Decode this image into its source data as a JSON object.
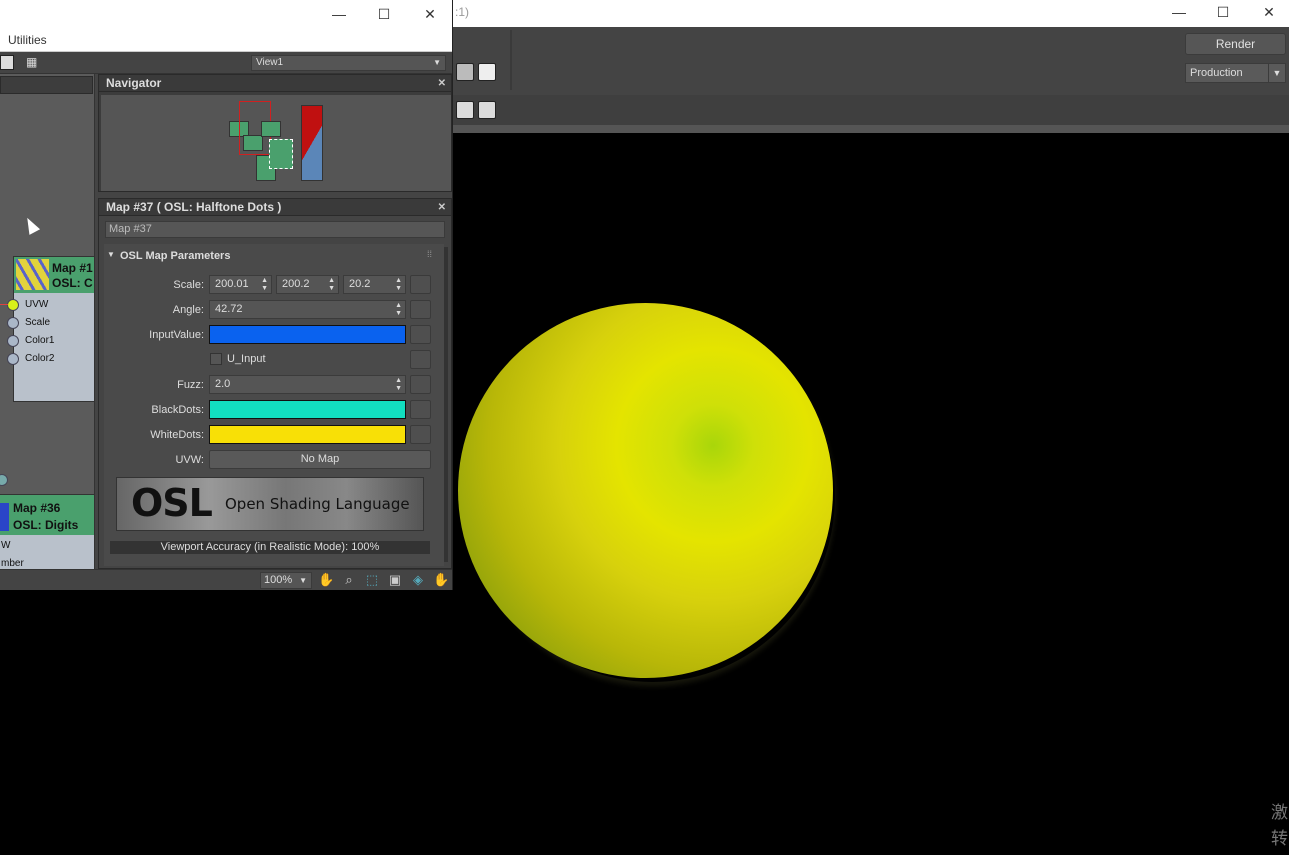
{
  "render_window": {
    "title_fragment": ":1)",
    "render_button": "Render",
    "preset": "Production",
    "watermark_line1": "激",
    "watermark_line2": "转",
    "sphere_colors": {
      "center": "#cfe008",
      "edge": "#6e8a10"
    }
  },
  "slate": {
    "menu": {
      "utilities": "Utilities"
    },
    "view_select": "View1",
    "navigator_title": "Navigator",
    "params_title": "Map #37  ( OSL: Halftone Dots )",
    "map_name": "Map #37",
    "rollout_title": "OSL Map Parameters",
    "params": {
      "scale_label": "Scale:",
      "scale_values": [
        "200.01",
        "200.2",
        "20.2"
      ],
      "angle_label": "Angle:",
      "angle_value": "42.72",
      "input_value_label": "InputValue:",
      "input_value_color": "#0a62ef",
      "u_input_label": "U_Input",
      "fuzz_label": "Fuzz:",
      "fuzz_value": "2.0",
      "black_dots_label": "BlackDots:",
      "black_dots_color": "#12dfc0",
      "white_dots_label": "WhiteDots:",
      "white_dots_color": "#f8e006",
      "uvw_label": "UVW:",
      "uvw_button": "No Map"
    },
    "osl_logo": {
      "big": "OSL",
      "sub": "Open Shading Language"
    },
    "accuracy": "Viewport Accuracy (in Realistic Mode): 100%",
    "zoom": "100%",
    "nodes": {
      "node1": {
        "title1": "Map #1",
        "title2": "OSL: C",
        "sockets": [
          "UVW",
          "Scale",
          "Color1",
          "Color2"
        ]
      },
      "node2": {
        "title1": "Map #36",
        "title2": "OSL: Digits",
        "sockets": [
          "W",
          "mber"
        ]
      }
    }
  }
}
